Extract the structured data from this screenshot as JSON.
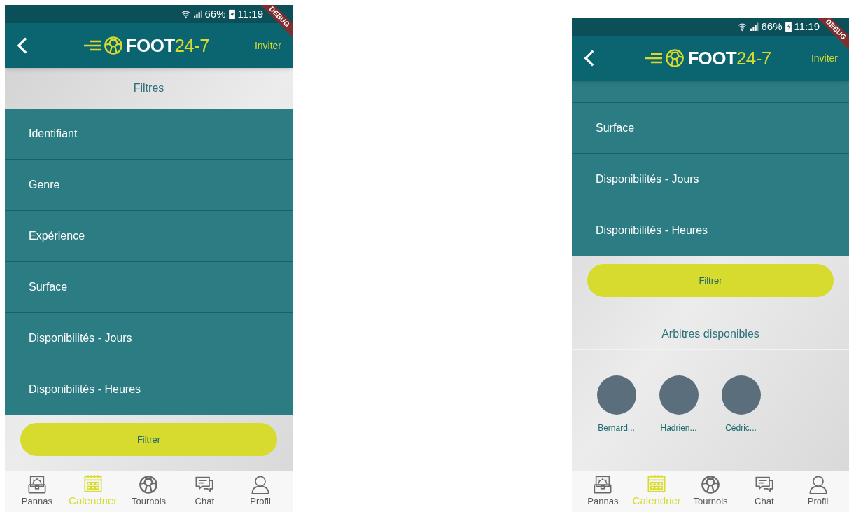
{
  "screens": [
    {
      "status_bar": {
        "battery": "66%",
        "time": "11:19"
      },
      "debug_banner": "DEBUG",
      "app_bar": {
        "logo_word": "FOOT",
        "logo_number": "24-7",
        "action": "Inviter"
      },
      "title": "Filtres",
      "partial_row": false,
      "filters": [
        {
          "label": "Identifiant"
        },
        {
          "label": "Genre"
        },
        {
          "label": "Expérience"
        },
        {
          "label": "Surface"
        },
        {
          "label": "Disponibilités - Jours"
        },
        {
          "label": "Disponibilités - Heures"
        }
      ],
      "filter_button": "Filtrer",
      "bottom_nav": [
        {
          "label": "Pannas",
          "kind": "chest",
          "selected": false
        },
        {
          "label": "Calendrier",
          "kind": "calendar",
          "selected": true
        },
        {
          "label": "Tournois",
          "kind": "ball",
          "selected": false
        },
        {
          "label": "Chat",
          "kind": "chat",
          "selected": false
        },
        {
          "label": "Profil",
          "kind": "profile",
          "selected": false
        }
      ]
    },
    {
      "status_bar": {
        "battery": "66%",
        "time": "11:19"
      },
      "debug_banner": "DEBUG",
      "app_bar": {
        "logo_word": "FOOT",
        "logo_number": "24-7",
        "action": "Inviter"
      },
      "partial_row": true,
      "filters": [
        {
          "label": "Surface"
        },
        {
          "label": "Disponibilités - Jours"
        },
        {
          "label": "Disponibilités - Heures"
        }
      ],
      "filter_button": "Filtrer",
      "referees": {
        "title": "Arbitres disponibles",
        "people": [
          {
            "name": "Bernard..."
          },
          {
            "name": "Hadrien..."
          },
          {
            "name": "Cédric..."
          }
        ]
      },
      "bottom_nav": [
        {
          "label": "Pannas",
          "kind": "chest",
          "selected": false
        },
        {
          "label": "Calendrier",
          "kind": "calendar",
          "selected": true
        },
        {
          "label": "Tournois",
          "kind": "ball",
          "selected": false
        },
        {
          "label": "Chat",
          "kind": "chat",
          "selected": false
        },
        {
          "label": "Profil",
          "kind": "profile",
          "selected": false
        }
      ]
    }
  ]
}
